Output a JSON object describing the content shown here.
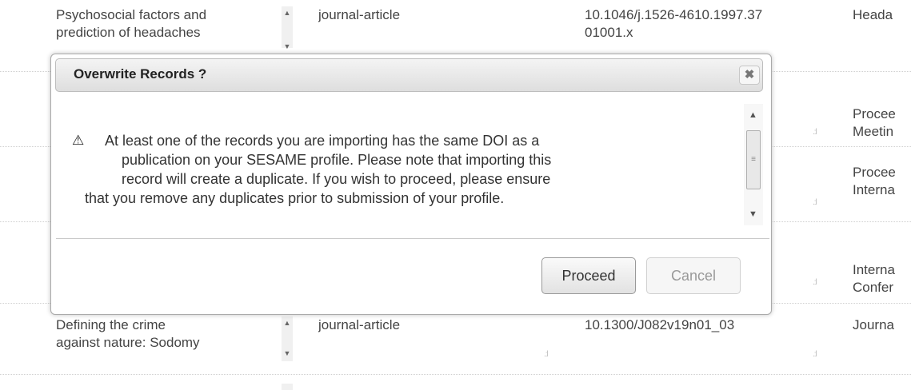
{
  "table": {
    "rows": [
      {
        "title_line1": "Psychosocial factors and",
        "title_line2": "prediction of headaches",
        "type": "journal-article",
        "doi_line1": "10.1046/j.1526-4610.1997.37",
        "doi_line2": "01001.x",
        "source_line1": "Heada",
        "source_line2": ""
      },
      {
        "title_line1": "",
        "title_line2": "",
        "type": "",
        "doi_line1": "",
        "doi_line2": "",
        "source_line1": "Procee",
        "source_line2": "Meetin"
      },
      {
        "title_line1": "",
        "title_line2": "",
        "type": "",
        "doi_line1": "",
        "doi_line2": "",
        "source_line1": "Procee",
        "source_line2": "Interna"
      },
      {
        "title_line1": "",
        "title_line2": "",
        "type": "",
        "doi_line1": "",
        "doi_line2": "",
        "source_line1": "Interna",
        "source_line2": "Confer"
      },
      {
        "title_line1": "Defining the crime",
        "title_line2": "against nature: Sodomy",
        "type": "journal-article",
        "doi_line1": "10.1300/J082v19n01_03",
        "doi_line2": "",
        "source_line1": "Journa",
        "source_line2": ""
      }
    ]
  },
  "modal": {
    "title": "Overwrite Records ?",
    "close_glyph": "✖",
    "warning_icon": "⚠",
    "message_line1": "At least one of the records you are importing has the same DOI as a",
    "message_line2": "publication on your SESAME profile. Please note that importing this",
    "message_line3": "record will create a duplicate. If you wish to proceed, please ensure",
    "message_line4": "that you remove any duplicates prior to submission of your profile.",
    "proceed_label": "Proceed",
    "cancel_label": "Cancel"
  },
  "icons": {
    "warning": "warning-icon",
    "close": "close-icon",
    "scroll_up": "chevron-up-icon",
    "scroll_down": "chevron-down-icon"
  }
}
